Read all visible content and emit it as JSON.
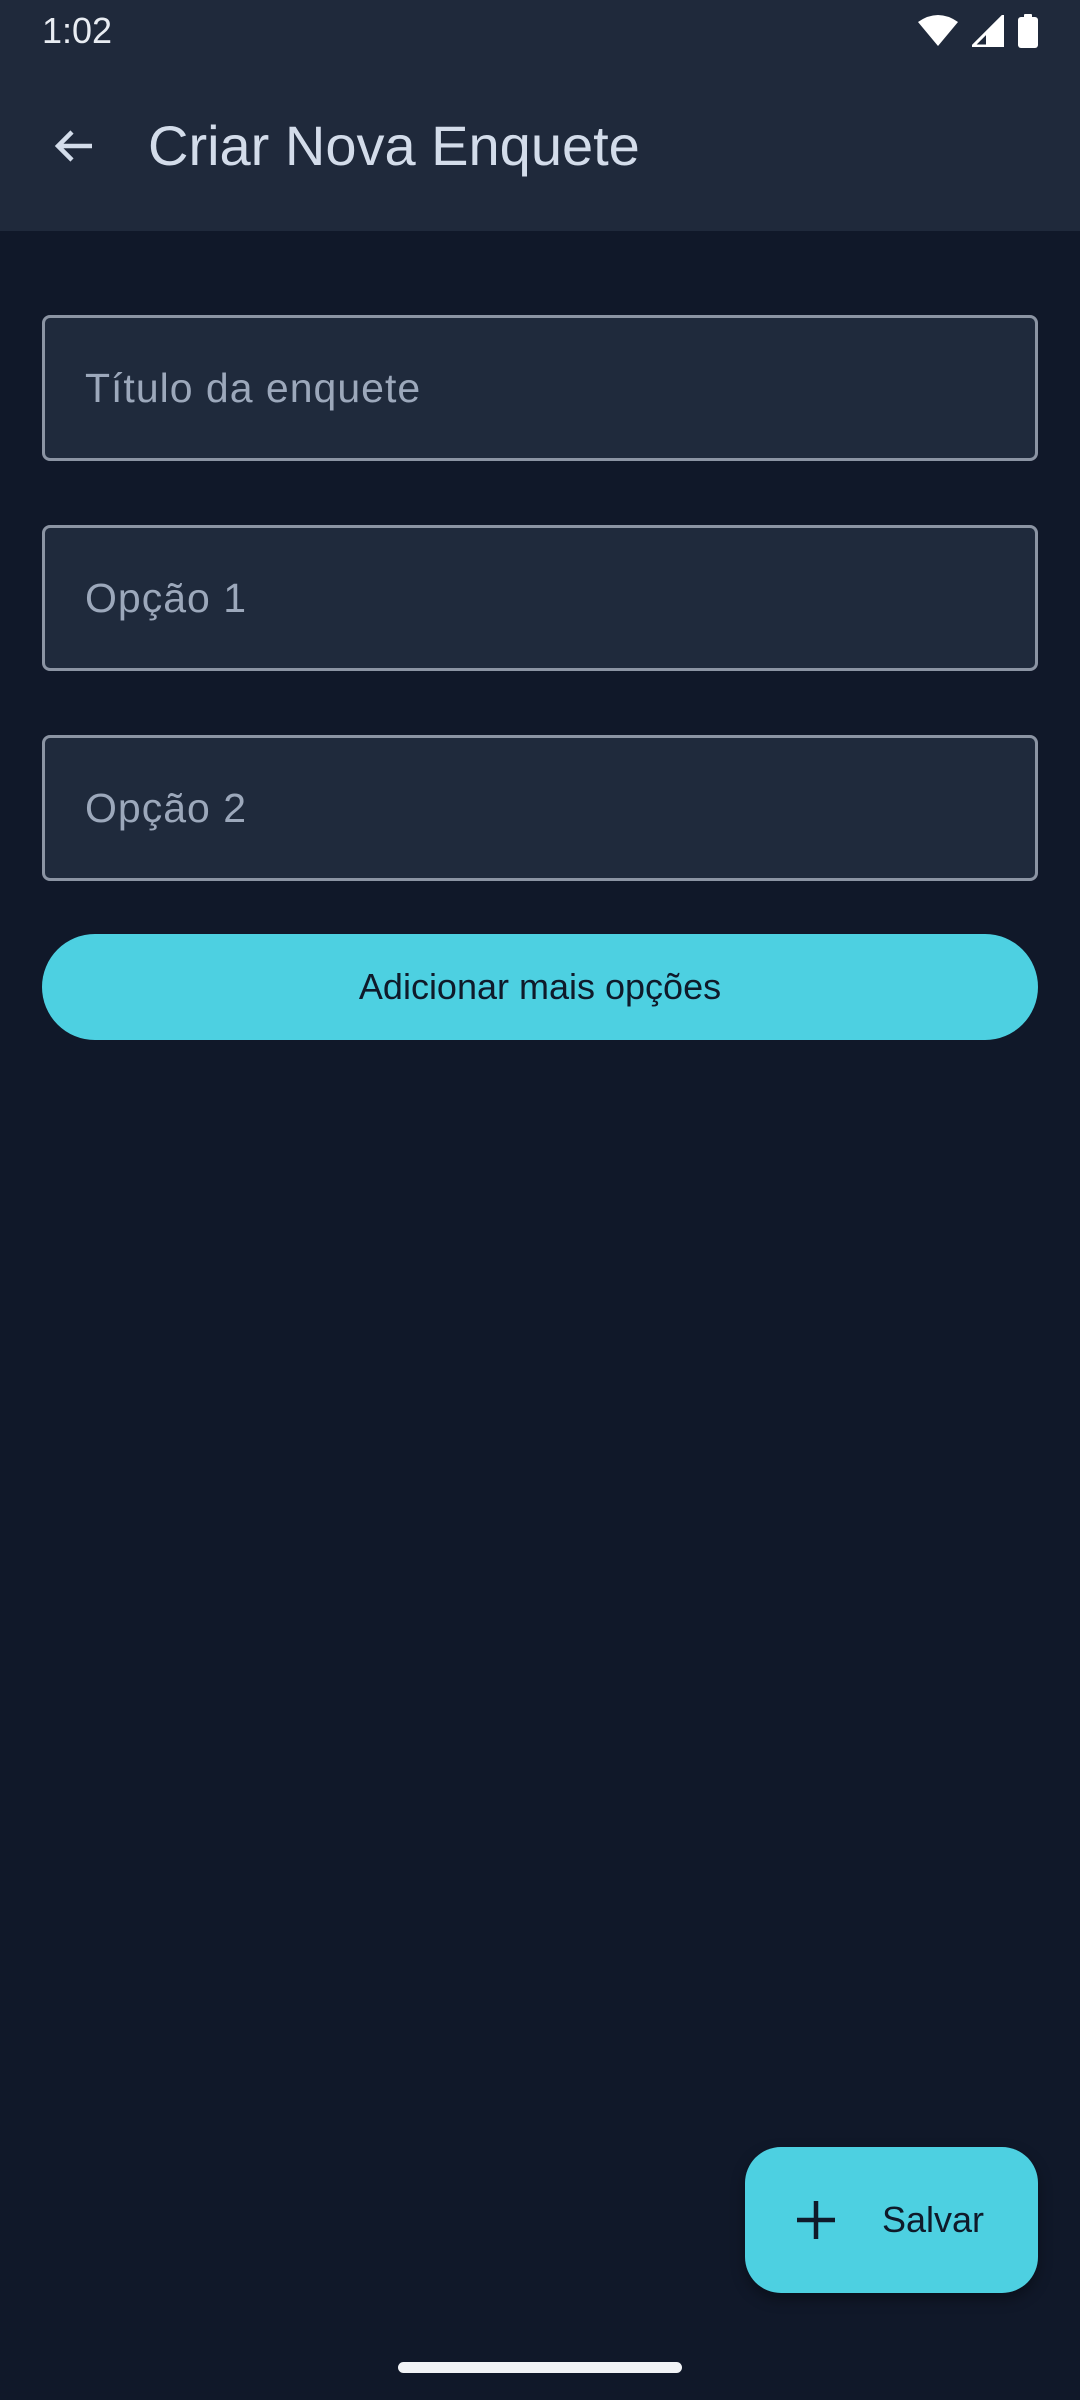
{
  "status_bar": {
    "time": "1:02",
    "icons": [
      "wifi-icon",
      "signal-icon",
      "battery-icon"
    ]
  },
  "app_bar": {
    "back_icon": "arrow-left-icon",
    "title": "Criar Nova Enquete"
  },
  "form": {
    "title_field": {
      "placeholder": "Título da enquete",
      "value": ""
    },
    "options": [
      {
        "placeholder": "Opção 1",
        "value": ""
      },
      {
        "placeholder": "Opção 2",
        "value": ""
      }
    ],
    "add_options_label": "Adicionar mais opções"
  },
  "fab": {
    "icon": "plus-icon",
    "label": "Salvar"
  },
  "colors": {
    "background": "#101829",
    "app_bar": "#1f293b",
    "field_background": "#1f2a3c",
    "field_border": "#8b94a3",
    "accent": "#4dd0e1",
    "title_text": "#d3dcea",
    "placeholder_text": "#9ca8bb"
  }
}
